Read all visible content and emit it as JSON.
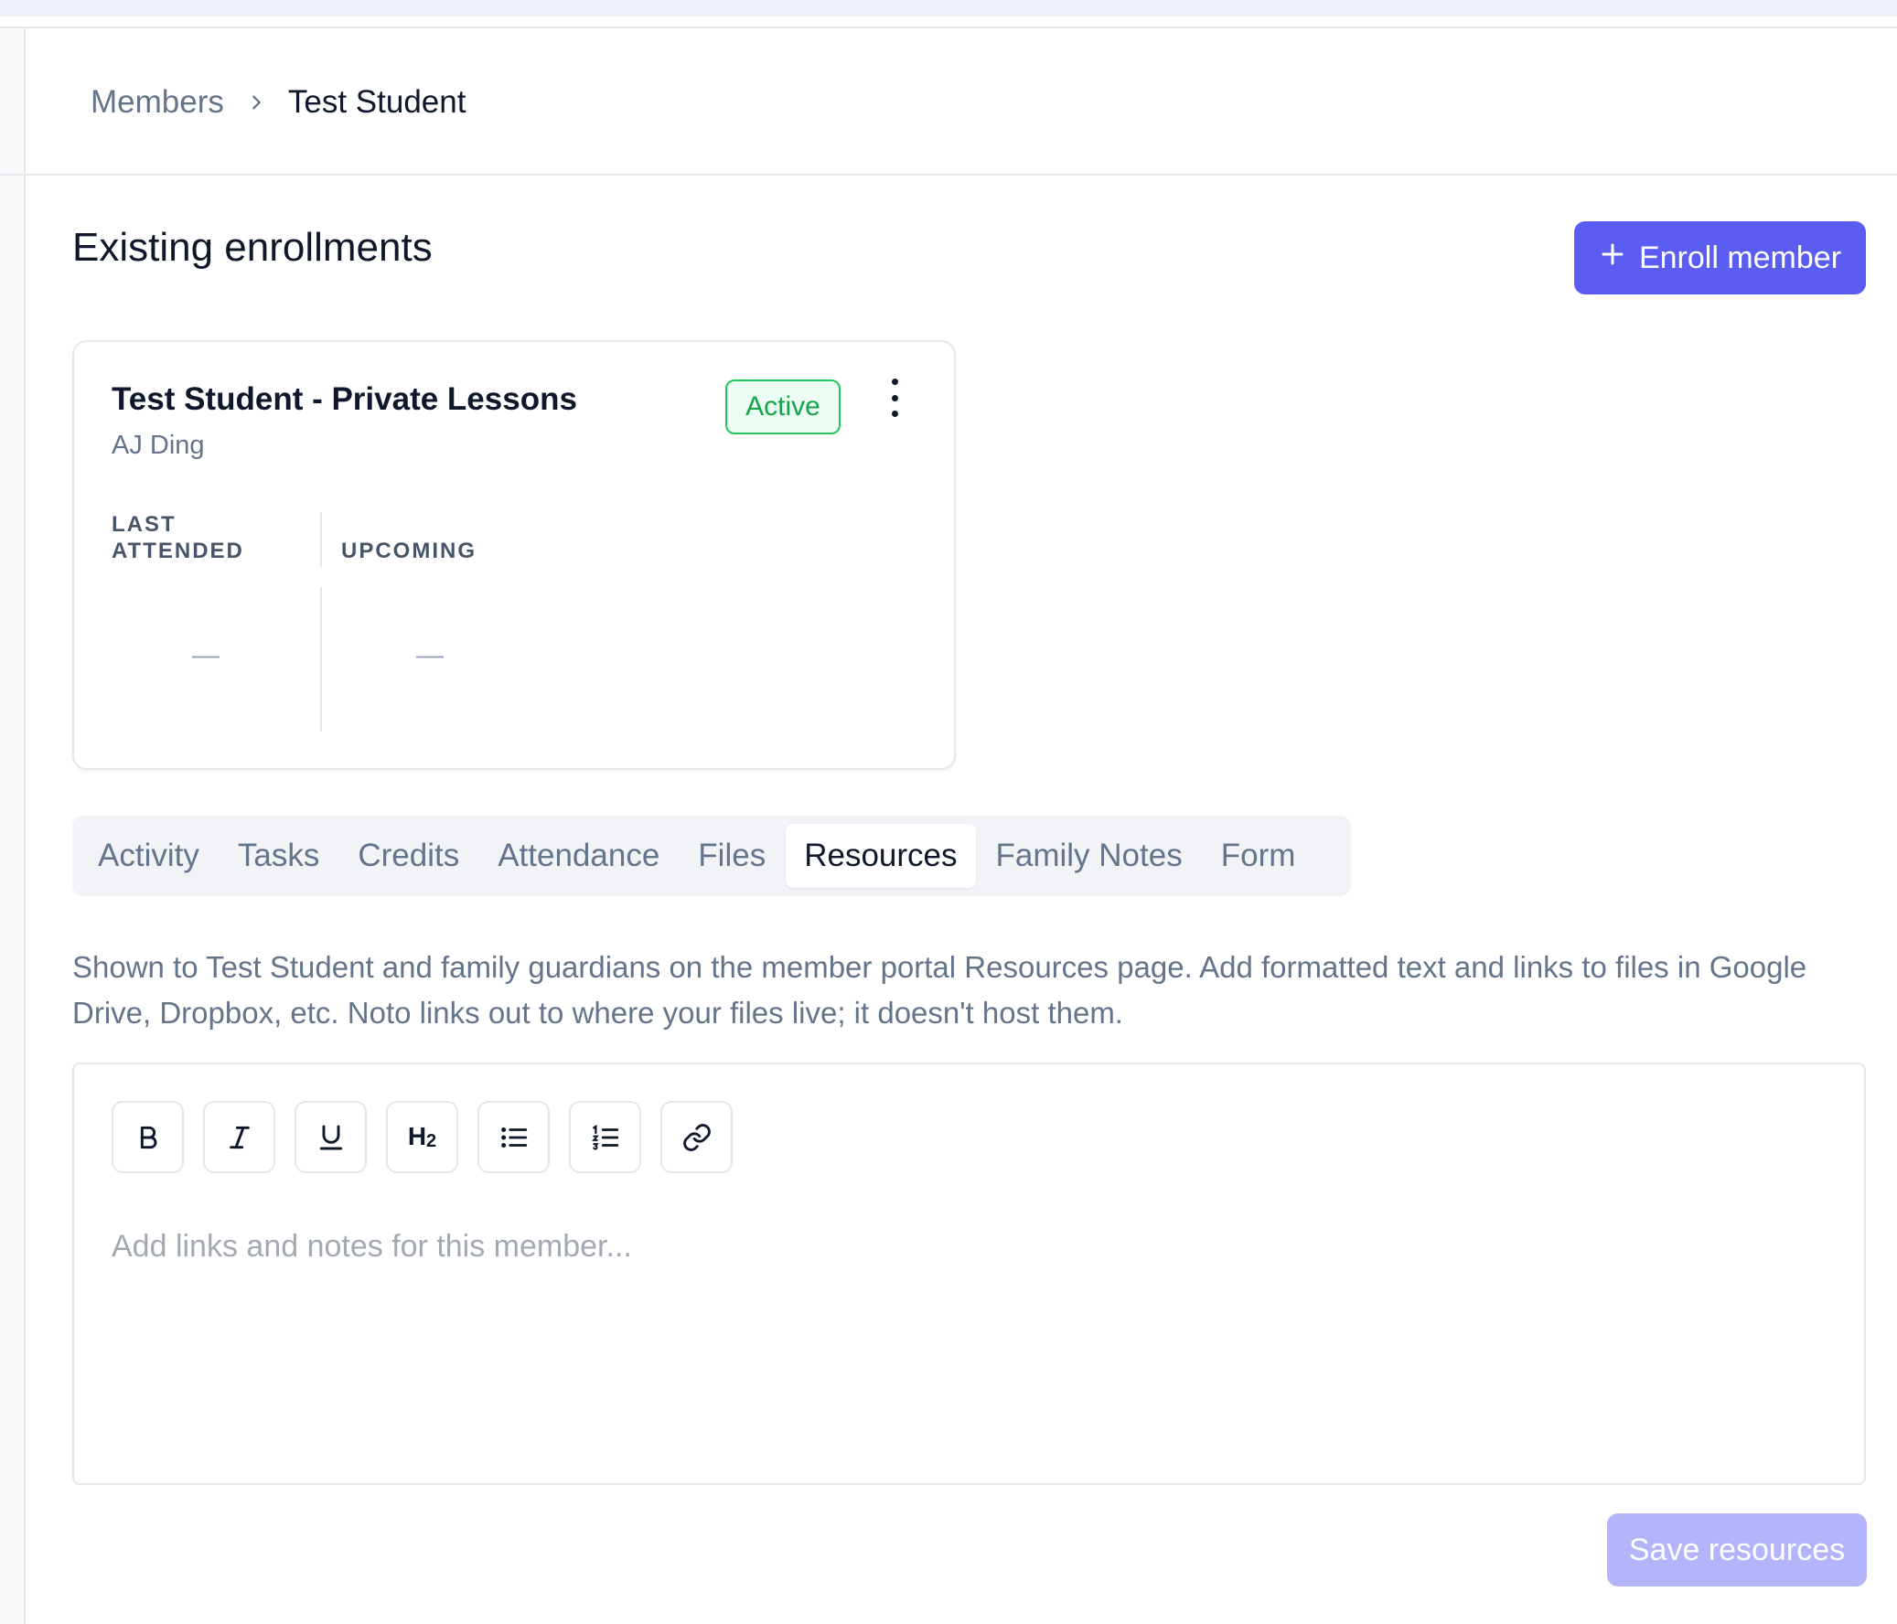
{
  "breadcrumb": {
    "parent": "Members",
    "current": "Test Student"
  },
  "section": {
    "title": "Existing enrollments",
    "enroll_button": "Enroll member"
  },
  "enrollment_card": {
    "title": "Test Student - Private Lessons",
    "instructor": "AJ Ding",
    "status": "Active",
    "status_color": "#16a34a",
    "last_attended_label": "LAST ATTENDED",
    "last_attended_value": "—",
    "upcoming_label": "UPCOMING",
    "upcoming_value": "—"
  },
  "tabs": [
    {
      "label": "Activity",
      "active": false
    },
    {
      "label": "Tasks",
      "active": false
    },
    {
      "label": "Credits",
      "active": false
    },
    {
      "label": "Attendance",
      "active": false
    },
    {
      "label": "Files",
      "active": false
    },
    {
      "label": "Resources",
      "active": true
    },
    {
      "label": "Family Notes",
      "active": false
    },
    {
      "label": "Form",
      "active": false
    }
  ],
  "resources": {
    "description": "Shown to Test Student and family guardians on the member portal Resources page. Add formatted text and links to files in Google Drive, Dropbox, etc. Noto links out to where your files live; it doesn't host them.",
    "editor_placeholder": "Add links and notes for this member...",
    "editor_value": "",
    "toolbar": [
      {
        "icon": "bold-icon"
      },
      {
        "icon": "italic-icon"
      },
      {
        "icon": "underline-icon"
      },
      {
        "icon": "heading-icon"
      },
      {
        "icon": "bullet-list-icon"
      },
      {
        "icon": "numbered-list-icon"
      },
      {
        "icon": "link-icon"
      }
    ],
    "save_button": "Save resources"
  },
  "colors": {
    "accent": "#5b5cf2",
    "accent_disabled": "#b4b4fa",
    "active_tab_bg": "#ffffff",
    "tabs_bg": "#f1f3f6"
  }
}
